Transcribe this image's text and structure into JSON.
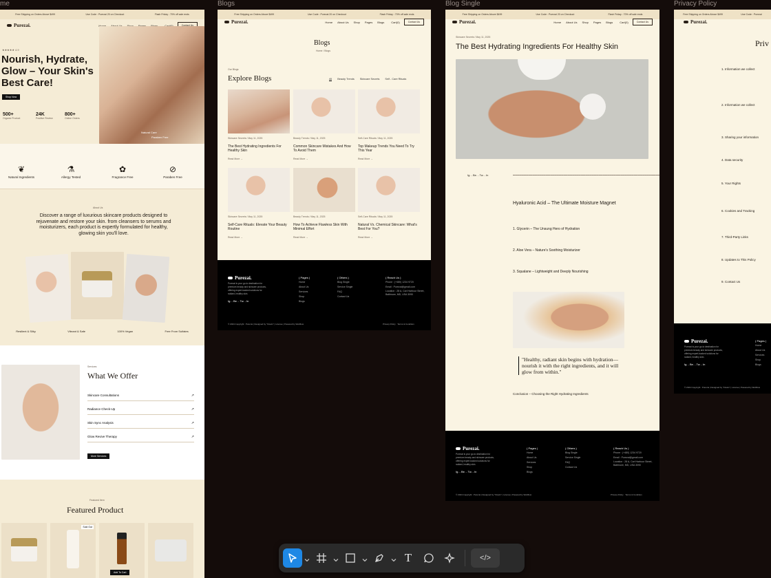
{
  "frame_labels": [
    "me",
    "Blogs",
    "Blog Single",
    "Privacy Policy"
  ],
  "brand": "Purezai.",
  "nav": {
    "items": [
      "Home",
      "About Us",
      "Shop",
      "Pages",
      "Blogs"
    ],
    "cart": "Cart(0)",
    "contact": "Contact Us"
  },
  "home": {
    "rating": "4.9",
    "hero_title": "Nourish, Hydrate, Glow – Your Skin's Best Care!",
    "shop_btn": "Shop Now",
    "stats": [
      {
        "num": "500+",
        "label": "Organic Product"
      },
      {
        "num": "24K",
        "label": "Positive Review"
      },
      {
        "num": "800+",
        "label": "Online Orders"
      }
    ],
    "badges": [
      "Natural Care",
      "Paraben Free"
    ],
    "features": [
      "Natural Ingredients",
      "Allergy Tested",
      "Fragrance Free",
      "Paraben Free"
    ],
    "about_tag": "About Us",
    "about_text": "Discover a range of luxurious skincare products designed to rejuvenate and restore your skin. from cleansers to serums and moisturizers, each product is expertly formulated for healthy, glowing skin you'll love.",
    "strip": [
      "Resilient & Silky",
      "Vibrant & Safe",
      "100% Vegan",
      "Free From Sulfates"
    ],
    "services_tag": "Services",
    "offer_title": "What We Offer",
    "offers": [
      "Skincare Consultations",
      "Radiance Check-Up",
      "Skin Sync Analysis",
      "Glow Revive Therapy"
    ],
    "more_services": "More Services",
    "featured_tag": "Featured Item",
    "featured_title": "Featured Product",
    "products": [
      "Glow Revive Serum",
      "Glow Revive Serum"
    ],
    "sold_out": "Sold Out",
    "add_to_cart": "Add To Cart"
  },
  "blogs": {
    "title": "Blogs",
    "crumb": "Home / Blogs",
    "tag": "Our Blogs",
    "heading": "Explore Blogs",
    "filters": [
      "All",
      "Beauty Trends",
      "Skincare Secrets",
      "Self - Care Rituals"
    ],
    "posts": [
      {
        "meta": "Skincare Secrets / May 11, 2025",
        "title": "The Best Hydrating Ingredients For Healthy Skin"
      },
      {
        "meta": "Beauty Trends / May 11, 2025",
        "title": "Common Skincare Mistakes And How To Avoid Them"
      },
      {
        "meta": "Self-Care Rituals / May 11, 2025",
        "title": "Top Makeup Trends You Need To Try This Year"
      },
      {
        "meta": "Skincare Secrets / May 11, 2025",
        "title": "Self-Care Rituals: Elevate Your Beauty Routine"
      },
      {
        "meta": "Beauty Trends / May 11, 2025",
        "title": "How To Achieve Flawless Skin With Minimal Effort"
      },
      {
        "meta": "Self-Care Rituals / May 11, 2025",
        "title": "Natural Vs. Chemical Skincare: What's Best For You?"
      }
    ],
    "read_more": "Read More"
  },
  "footer": {
    "about": "Purezai is your go-to destination for premium beauty and skincare products, offering expert-backed solutions for radiant, healthy skin.",
    "social": "Ig. - Be. - Tw. - In",
    "pages_head": "( Pages )",
    "pages": [
      "Home",
      "About Us",
      "Services",
      "Shop",
      "Blogs"
    ],
    "others_head": "( Others )",
    "others": [
      "Blog Single",
      "Service Single",
      "FAQ",
      "Contact Us"
    ],
    "reach_head": "( Reach Us )",
    "phone": "Phone : (+480) 1234 9720",
    "email": "Email : Purezai@gmail.com",
    "location": "Location : 28 A, Carl Harbour Street, Baltimore, MD, USA 3090",
    "copyright": "© 2024 Copyright : Purezai | Designed by \"Flowix\" | License | Powered by Webflow",
    "legal": [
      "Privacy Policy",
      "Terms & Condition"
    ]
  },
  "single": {
    "meta": "Skincare Secrets / May 11, 2025",
    "title": "The Best Hydrating Ingredients For Healthy Skin",
    "social": "Ig. - Be. - Tw. - In",
    "h2": "Hyaluronic Acid – The Ultimate Moisture Magnet",
    "points": [
      "1. Glycerin – The Unsung Hero of Hydration",
      "2. Aloe Vera – Nature's Soothing Moisturizer",
      "3. Squalane – Lightweight and Deeply Nourishing"
    ],
    "quote": "\"Healthy, radiant skin begins with hydration—nourish it with the right ingredients, and it will glow from within.\"",
    "conclusion": "Conclusion – Choosing the Right Hydrating Ingredients"
  },
  "privacy": {
    "title": "Priv",
    "sections": [
      "1. Information we collect",
      "2. Information we collect",
      "3. Sharing your information",
      "4. Data security",
      "5. Your Rights",
      "6. Cookies and Tracking",
      "7. Third-Party Links",
      "8. Updates to This Policy",
      "9. Contact Us"
    ]
  },
  "toolbar": [
    "select-tool",
    "frame-tool",
    "shape-tool",
    "pen-tool",
    "text-tool",
    "comment-tool",
    "ai-tool",
    "code-view"
  ]
}
